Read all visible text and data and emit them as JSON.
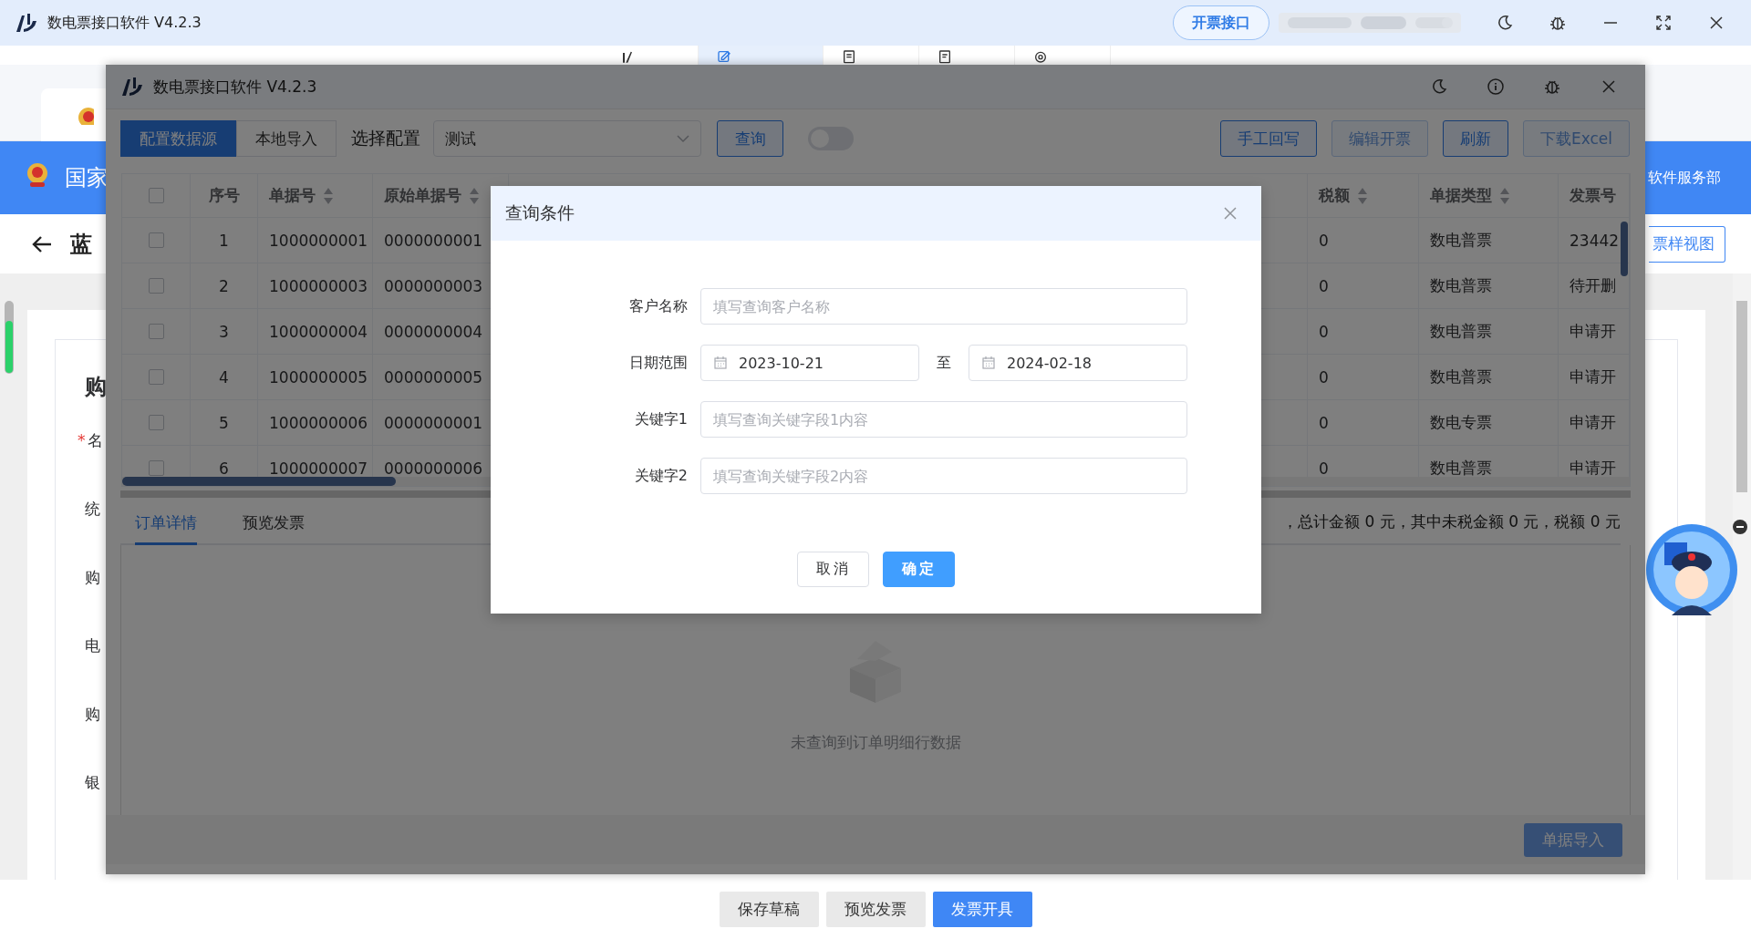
{
  "app": {
    "title": "数电票接口软件 V4.2.3",
    "mode_button": "开票接口"
  },
  "nav_tabs": [
    {
      "selected": false
    },
    {
      "selected": true
    },
    {
      "selected": false
    },
    {
      "selected": false
    },
    {
      "selected": false
    }
  ],
  "banner": {
    "site_name": "国家",
    "service": "软件服务部"
  },
  "page": {
    "back_title": "蓝",
    "sample_view_button": "票样视图",
    "section_title": "购",
    "form_labels": [
      {
        "text": "名",
        "required_mark": "*"
      },
      {
        "text": "统"
      },
      {
        "text": "购"
      },
      {
        "text": "电"
      },
      {
        "text": "购"
      },
      {
        "text": "银"
      }
    ]
  },
  "footer_buttons": [
    {
      "label": "保存草稿",
      "kind": "default"
    },
    {
      "label": "预览发票",
      "kind": "default"
    },
    {
      "label": "发票开具",
      "kind": "primary"
    }
  ],
  "window": {
    "title": "数电票接口软件 V4.2.3",
    "source_tabs": [
      {
        "label": "配置数据源",
        "selected": true
      },
      {
        "label": "本地导入",
        "selected": false
      }
    ],
    "config_label": "选择配置",
    "config_value": "测试",
    "query_button": "查询",
    "toggle": {
      "on": false
    },
    "actions": [
      {
        "label": "手工回写",
        "disabled": false
      },
      {
        "label": "编辑开票",
        "disabled": true
      },
      {
        "label": "刷新",
        "disabled": false
      },
      {
        "label": "下载Excel",
        "disabled": true
      }
    ],
    "table": {
      "header_checked": false,
      "columns": [
        {
          "label": "序号",
          "sortable": false
        },
        {
          "label": "单据号",
          "sortable": true
        },
        {
          "label": "原始单据号",
          "sortable": true
        },
        {
          "label": "税额",
          "sortable": true
        },
        {
          "label": "单据类型",
          "sortable": true
        },
        {
          "label": "发票号",
          "sortable": false
        }
      ],
      "rows": [
        {
          "checked": false,
          "cells": [
            "1",
            "1000000001",
            "0000000001",
            "0",
            "数电普票",
            "23442"
          ]
        },
        {
          "checked": false,
          "cells": [
            "2",
            "1000000003",
            "0000000003",
            "0",
            "数电普票",
            "待开删"
          ]
        },
        {
          "checked": false,
          "cells": [
            "3",
            "1000000004",
            "0000000004",
            "0",
            "数电普票",
            "申请开"
          ]
        },
        {
          "checked": false,
          "cells": [
            "4",
            "1000000005",
            "0000000005",
            "0",
            "数电普票",
            "申请开"
          ]
        },
        {
          "checked": false,
          "cells": [
            "5",
            "1000000006",
            "0000000001",
            "0",
            "数电专票",
            "申请开"
          ]
        },
        {
          "checked": false,
          "cells": [
            "6",
            "1000000007",
            "0000000006",
            "0",
            "数电普票",
            "申请开"
          ]
        }
      ]
    },
    "detail_tabs": [
      {
        "label": "订单详情",
        "selected": true
      },
      {
        "label": "预览发票",
        "selected": false
      }
    ],
    "summary": "，总计金额 0 元，其中未税金额 0 元，税额 0 元",
    "empty_text": "未查询到订单明细行数据",
    "import_button": {
      "label": "单据导入",
      "disabled": true
    }
  },
  "dialog": {
    "title": "查询条件",
    "fields": [
      {
        "kind": "text",
        "label": "客户名称",
        "placeholder": "填写查询客户名称"
      },
      {
        "kind": "date_range",
        "label": "日期范围",
        "from": "2023-10-21",
        "separator": "至",
        "to": "2024-02-18"
      },
      {
        "kind": "text",
        "label": "关键字1",
        "placeholder": "填写查询关键字段1内容"
      },
      {
        "kind": "text",
        "label": "关键字2",
        "placeholder": "填写查询关键字段2内容"
      }
    ],
    "buttons": [
      {
        "label": "取消",
        "kind": "default"
      },
      {
        "label": "确定",
        "kind": "primary"
      }
    ]
  }
}
